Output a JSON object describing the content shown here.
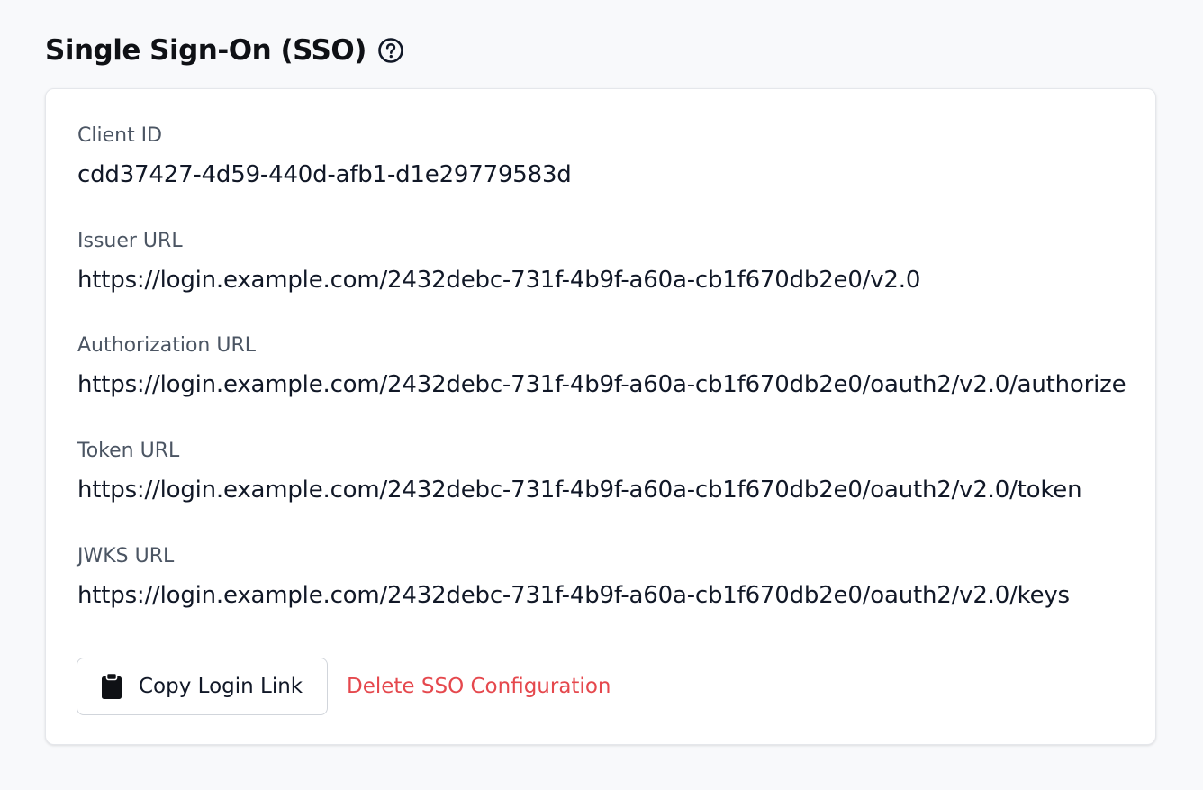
{
  "header": {
    "title": "Single Sign-On (SSO)",
    "help_icon": "question-circle-icon"
  },
  "fields": [
    {
      "label": "Client ID",
      "value": "cdd37427-4d59-440d-afb1-d1e29779583d"
    },
    {
      "label": "Issuer URL",
      "value": "https://login.example.com/2432debc-731f-4b9f-a60a-cb1f670db2e0/v2.0"
    },
    {
      "label": "Authorization URL",
      "value": "https://login.example.com/2432debc-731f-4b9f-a60a-cb1f670db2e0/oauth2/v2.0/authorize"
    },
    {
      "label": "Token URL",
      "value": "https://login.example.com/2432debc-731f-4b9f-a60a-cb1f670db2e0/oauth2/v2.0/token"
    },
    {
      "label": "JWKS URL",
      "value": "https://login.example.com/2432debc-731f-4b9f-a60a-cb1f670db2e0/oauth2/v2.0/keys"
    }
  ],
  "actions": {
    "copy_label": "Copy Login Link",
    "copy_icon": "clipboard-icon",
    "delete_label": "Delete SSO Configuration"
  },
  "colors": {
    "danger": "#e5484d",
    "background": "#f8f9fb",
    "card": "#ffffff"
  }
}
